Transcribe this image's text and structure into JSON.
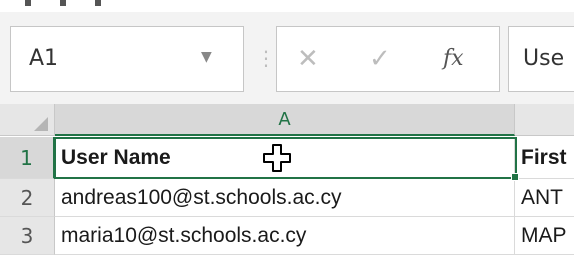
{
  "formula_bar": {
    "name_box": "A1",
    "dots_icon": "vertical-dots-icon",
    "cancel_icon": "cancel-x-icon",
    "enter_icon": "checkmark-icon",
    "function_label": "fx",
    "formula_value": "Use"
  },
  "grid": {
    "columns": [
      "A",
      ""
    ],
    "rows": [
      "1",
      "2",
      "3"
    ],
    "cells": [
      [
        "User Name",
        "First"
      ],
      [
        "andreas100@st.schools.ac.cy",
        "ANT"
      ],
      [
        "maria10@st.schools.ac.cy",
        "MAP"
      ]
    ]
  },
  "colors": {
    "accent": "#217346",
    "header_bg": "#e6e6e6",
    "active_header_bg": "#d8d8d8"
  },
  "cursor": "plus-cross-cursor-icon"
}
